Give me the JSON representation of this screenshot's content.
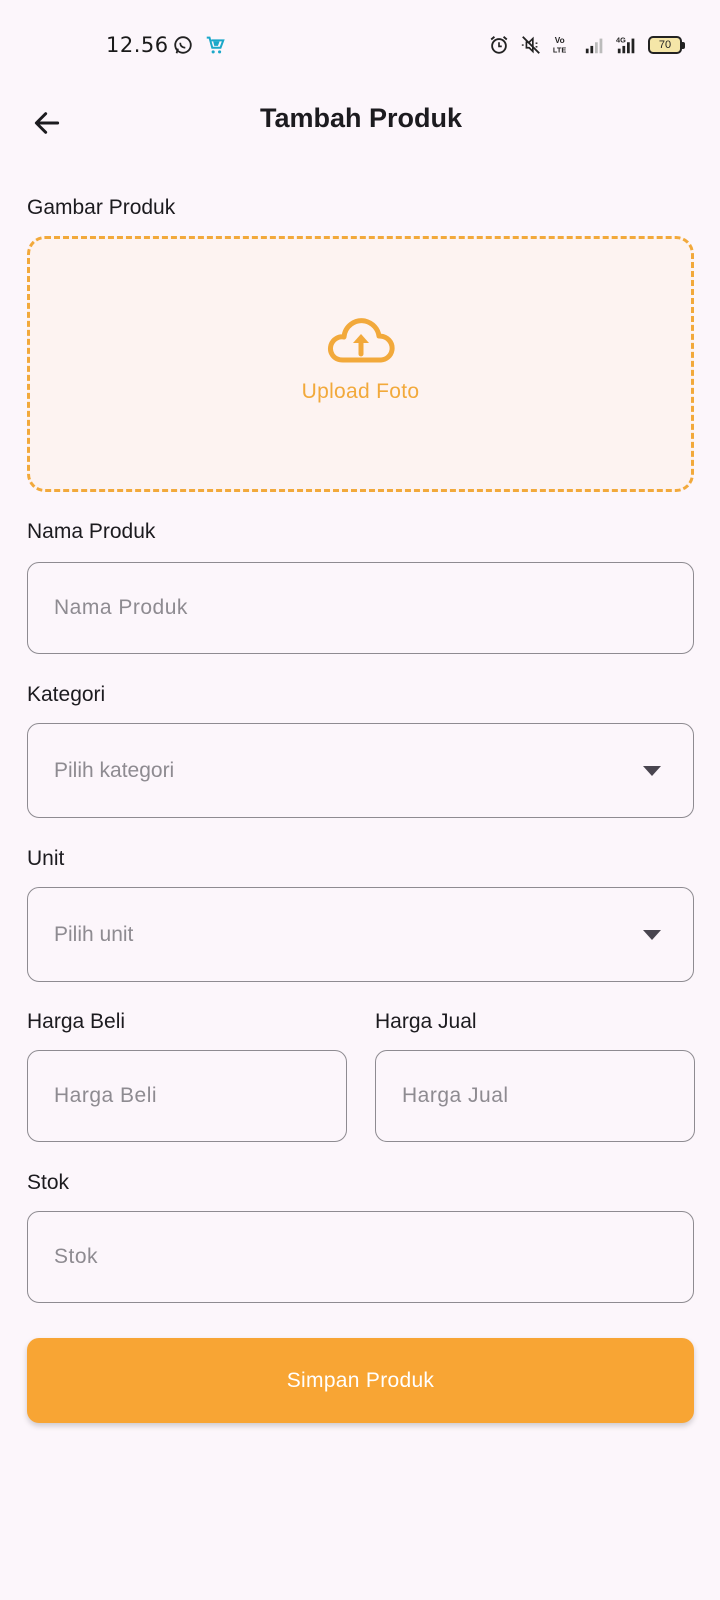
{
  "status_bar": {
    "time": "12.56",
    "battery_level": "70",
    "icons": [
      "whatsapp-icon",
      "shopping-cart-app-icon",
      "alarm-icon",
      "mute-icon",
      "volte-icon",
      "signal-icon",
      "4g-signal-icon",
      "battery-icon"
    ]
  },
  "app_bar": {
    "title": "Tambah Produk",
    "back_icon": "arrow-left-icon"
  },
  "image_section": {
    "label": "Gambar Produk",
    "upload_label": "Upload Foto",
    "icon": "cloud-upload-icon",
    "accent_color": "#f2a93b"
  },
  "fields": {
    "name": {
      "label": "Nama Produk",
      "placeholder": "Nama Produk"
    },
    "category": {
      "label": "Kategori",
      "placeholder": "Pilih kategori"
    },
    "unit": {
      "label": "Unit",
      "placeholder": "Pilih unit"
    },
    "buy_price": {
      "label": "Harga Beli",
      "placeholder": "Harga Beli"
    },
    "sell_price": {
      "label": "Harga Jual",
      "placeholder": "Harga Jual"
    },
    "stock": {
      "label": "Stok",
      "placeholder": "Stok"
    }
  },
  "save_button": {
    "label": "Simpan Produk",
    "color": "#f8a534"
  },
  "colors": {
    "background": "#fcf6fb",
    "border": "#8e8b91",
    "accent": "#f8a534"
  }
}
